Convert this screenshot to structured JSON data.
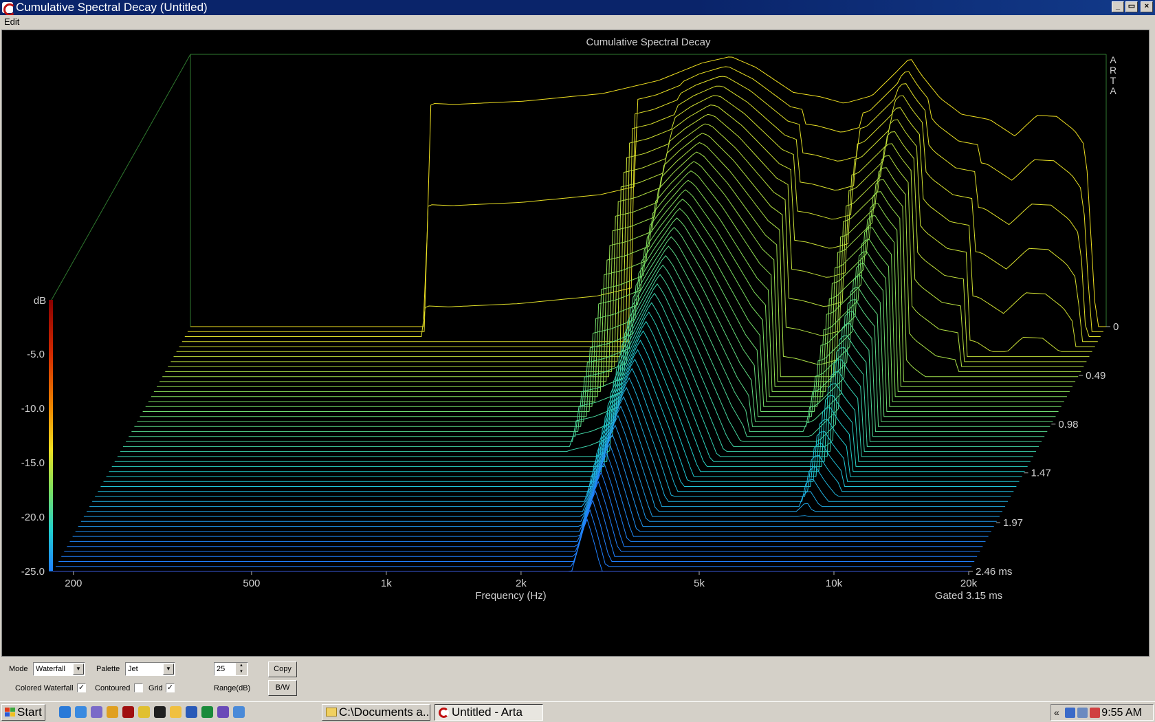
{
  "window": {
    "title": "Cumulative Spectral Decay  (Untitled)",
    "buttons": {
      "minimize": "_",
      "restore": "▭",
      "close": "×"
    }
  },
  "menu": {
    "edit": "Edit"
  },
  "chart_data": {
    "type": "waterfall",
    "title": "Cumulative Spectral Decay",
    "watermark": "ARTA",
    "xlabel": "Frequency (Hz)",
    "x_ticks": [
      "200",
      "500",
      "1k",
      "2k",
      "5k",
      "10k",
      "20k"
    ],
    "x_tick_values": [
      200,
      500,
      1000,
      2000,
      5000,
      10000,
      20000
    ],
    "xlim": [
      180,
      20000
    ],
    "x_scale": "log",
    "ylabel": "dB",
    "y_ticks": [
      "-5.0",
      "-10.0",
      "-15.0",
      "-20.0",
      "-25.0"
    ],
    "y_tick_values": [
      -5,
      -10,
      -15,
      -20,
      -25
    ],
    "ylim": [
      -25,
      0
    ],
    "z_label": "ms",
    "z_ticks": [
      "0",
      "0.49",
      "0.98",
      "1.47",
      "1.97",
      "2.46 ms"
    ],
    "z_tick_values": [
      0,
      0.49,
      0.98,
      1.47,
      1.97,
      2.46
    ],
    "zlim": [
      0,
      2.46
    ],
    "gated_label": "Gated 3.15 ms",
    "palette": "Jet",
    "colorbar_colors": [
      "#8b0000",
      "#d42a00",
      "#f08a00",
      "#f0e020",
      "#7ce060",
      "#20d0d0",
      "#2080ff"
    ],
    "series_count": 50,
    "first_slice_response": [
      [
        180,
        -25
      ],
      [
        600,
        -25
      ],
      [
        620,
        -4.5
      ],
      [
        700,
        -4.6
      ],
      [
        1000,
        -4.3
      ],
      [
        1500,
        -3.6
      ],
      [
        2000,
        -2.4
      ],
      [
        2500,
        -0.8
      ],
      [
        2900,
        -0.2
      ],
      [
        3300,
        -1.2
      ],
      [
        4000,
        -3.5
      ],
      [
        4600,
        -3.9
      ],
      [
        5200,
        -4.5
      ],
      [
        6000,
        -3.8
      ],
      [
        6800,
        -1.6
      ],
      [
        7300,
        -0.3
      ],
      [
        7700,
        -1.8
      ],
      [
        8500,
        -4.0
      ],
      [
        9500,
        -5.5
      ],
      [
        11000,
        -6.0
      ],
      [
        12500,
        -7.5
      ],
      [
        14000,
        -5.6
      ],
      [
        15500,
        -5.7
      ],
      [
        17000,
        -7.0
      ],
      [
        18000,
        -8.5
      ],
      [
        19000,
        -25
      ],
      [
        20000,
        -25
      ]
    ]
  },
  "controls": {
    "mode_label": "Mode",
    "mode_value": "Waterfall",
    "palette_label": "Palette",
    "palette_value": "Jet",
    "range_value": "25",
    "range_label": "Range(dB)",
    "copy_label": "Copy",
    "bw_label": "B/W",
    "colored_waterfall_label": "Colored Waterfall",
    "colored_waterfall_checked": true,
    "contoured_label": "Contoured",
    "contoured_checked": false,
    "grid_label": "Grid",
    "grid_checked": true,
    "check_mark": "✓",
    "spin_up": "▲",
    "spin_down": "▼",
    "dropdown_arrow": "▼"
  },
  "taskbar": {
    "start_label": "Start",
    "tasks": [
      {
        "label": "C:\\Documents a...",
        "icon": "folder-icon",
        "active": false
      },
      {
        "label": "Untitled - Arta",
        "icon": "arta-icon",
        "active": true
      }
    ],
    "quick_launch": [
      "ie-icon",
      "outlook-icon",
      "media-icon",
      "chrome-icon",
      "cmd-icon",
      "folder-icon",
      "word-icon",
      "excel-icon",
      "help-icon",
      "notepad-icon",
      "app-icon",
      "shark-icon"
    ],
    "tray_chevron": "«",
    "clock": "9:55 AM"
  }
}
